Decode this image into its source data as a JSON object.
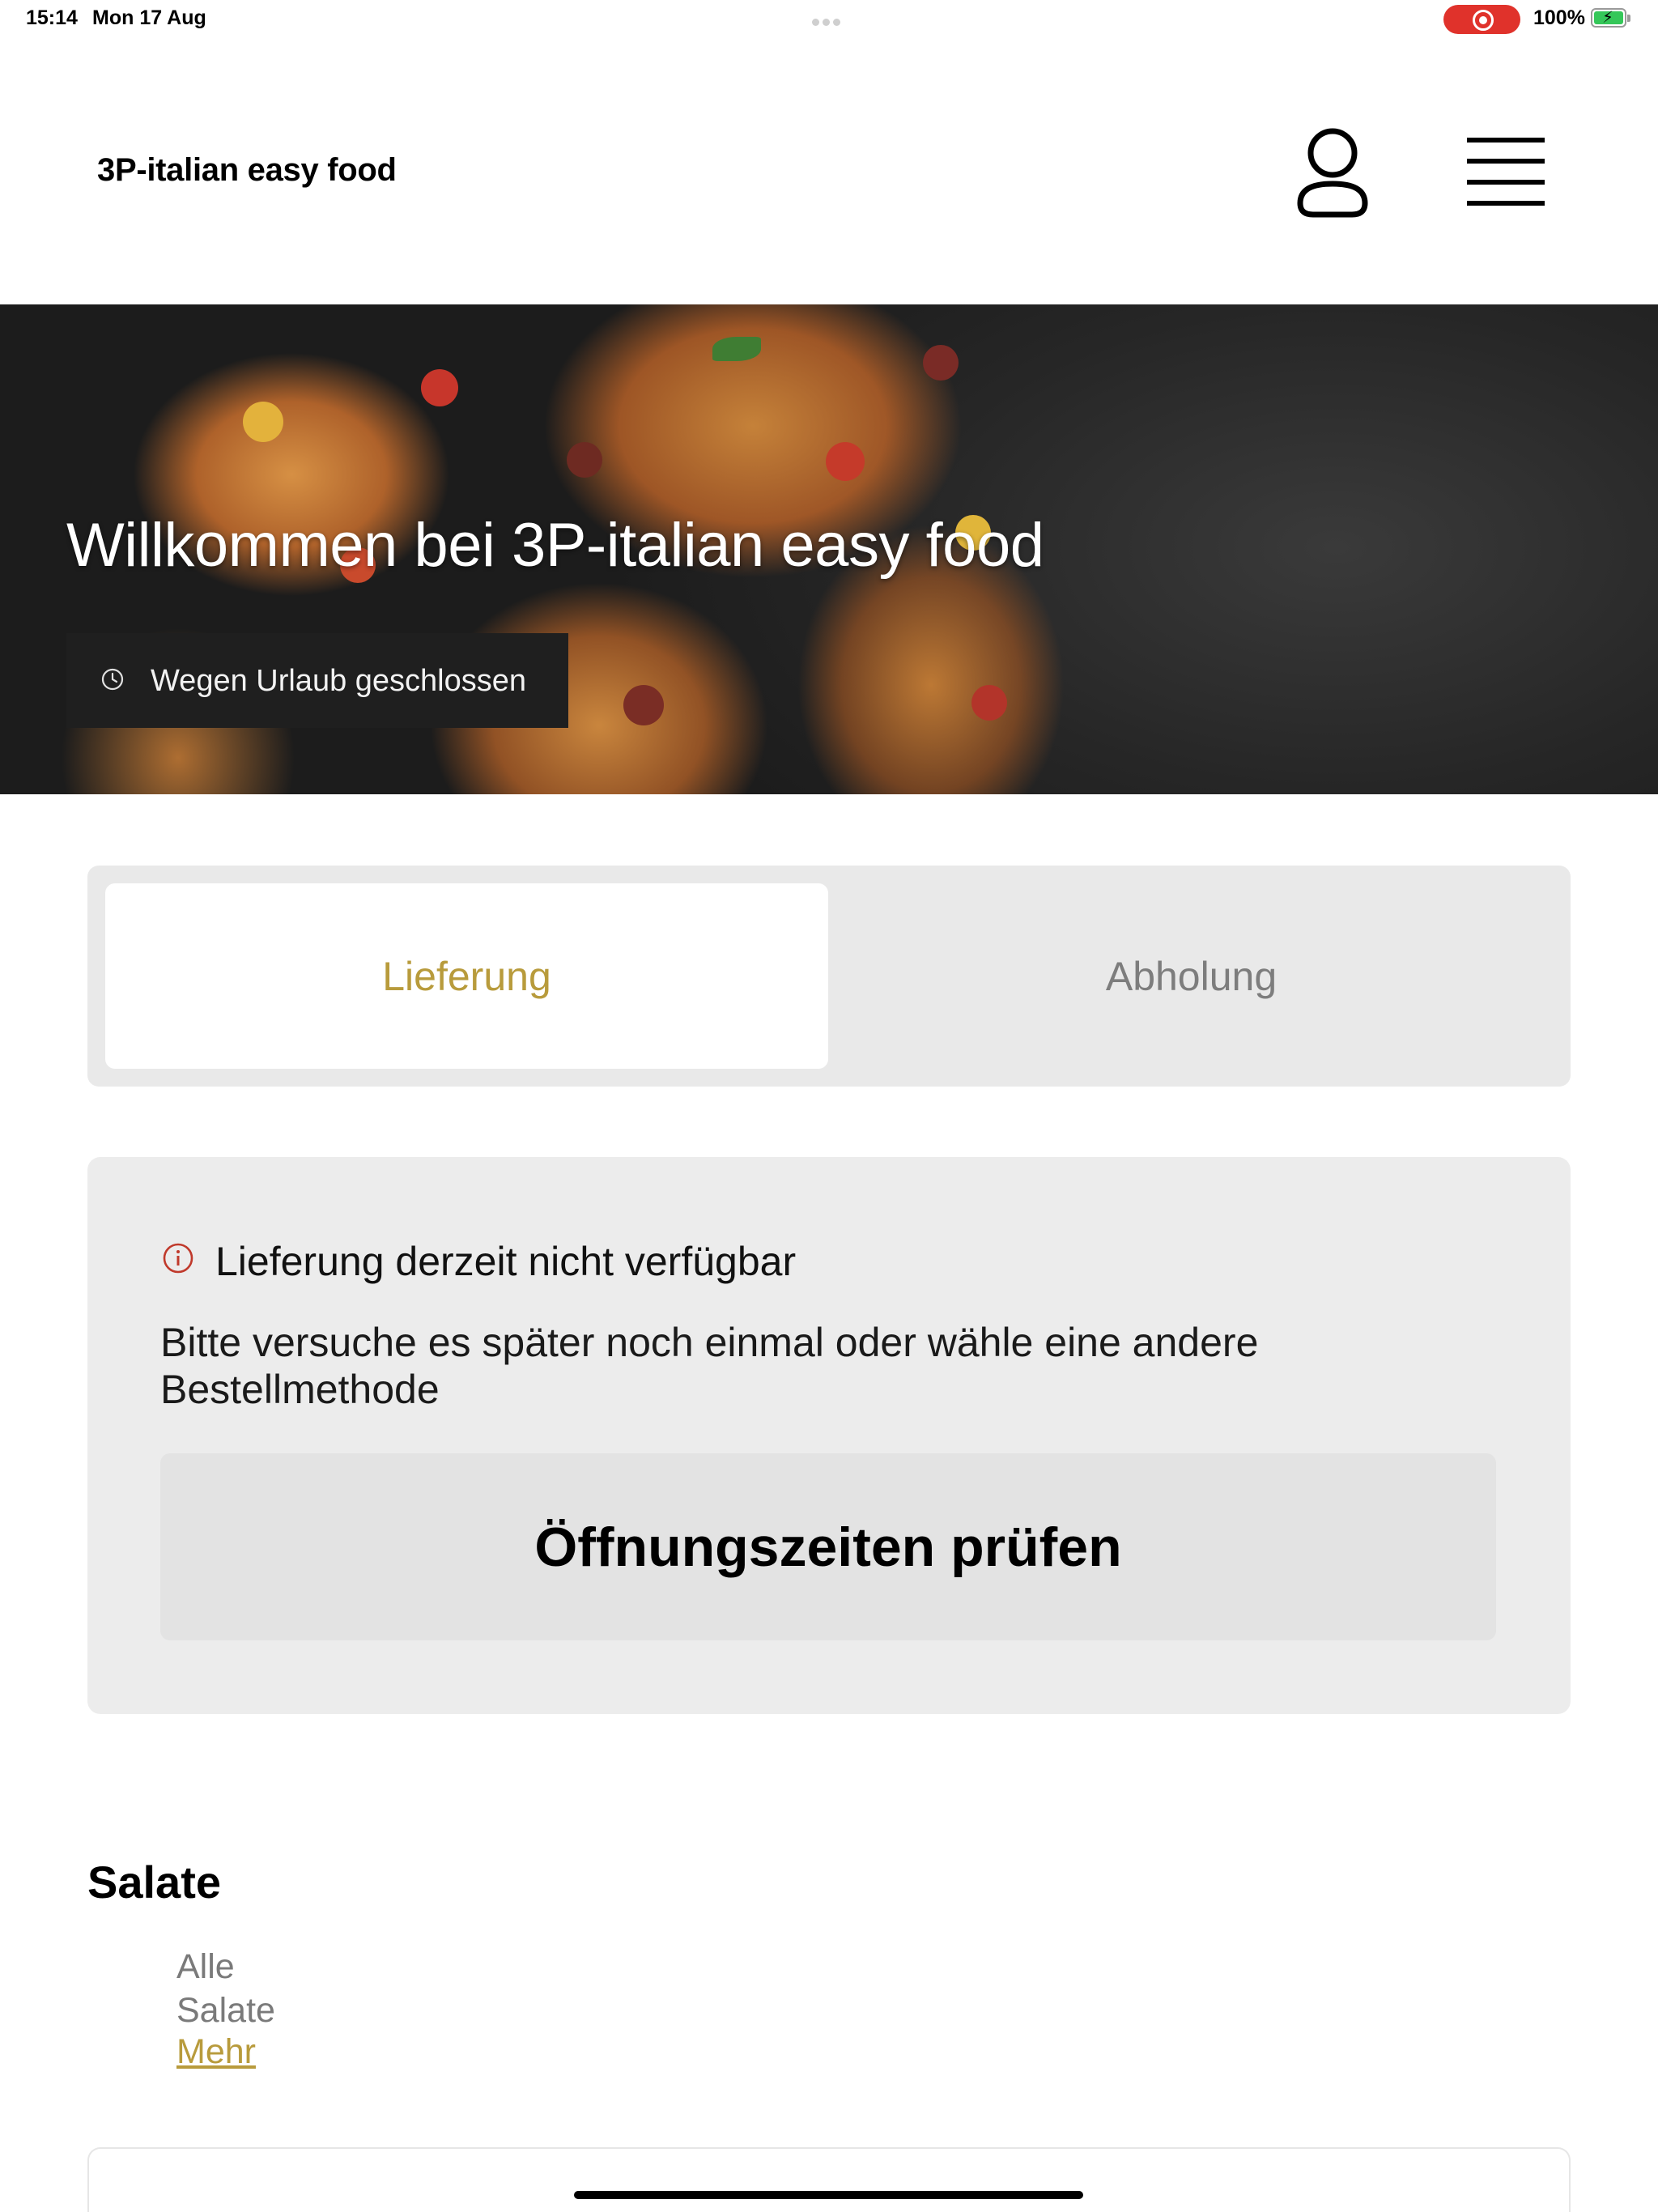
{
  "status_bar": {
    "time": "15:14",
    "date": "Mon 17 Aug",
    "battery_percent": "100%",
    "recording_color": "#e0322b",
    "battery_color": "#35c759"
  },
  "header": {
    "brand": "3P-italian easy food",
    "profile_icon": "user-icon",
    "menu_icon": "hamburger-menu-icon"
  },
  "hero": {
    "title": "Willkommen bei 3P-italian easy food",
    "status_badge": "Wegen Urlaub geschlossen",
    "status_icon": "clock-icon"
  },
  "order_method": {
    "options": [
      "Lieferung",
      "Abholung"
    ],
    "selected": "Lieferung",
    "accent_color": "#b89b3c"
  },
  "notice": {
    "icon": "info-icon",
    "icon_color": "#c0392b",
    "title": "Lieferung derzeit nicht verfügbar",
    "text": "Bitte versuche es später noch einmal oder wähle eine andere Bestellmethode",
    "button_label": "Öffnungszeiten prüfen"
  },
  "category": {
    "title": "Salate",
    "subtitle_line1": "Alle",
    "subtitle_line2": "Salate",
    "more_link": "Mehr"
  }
}
